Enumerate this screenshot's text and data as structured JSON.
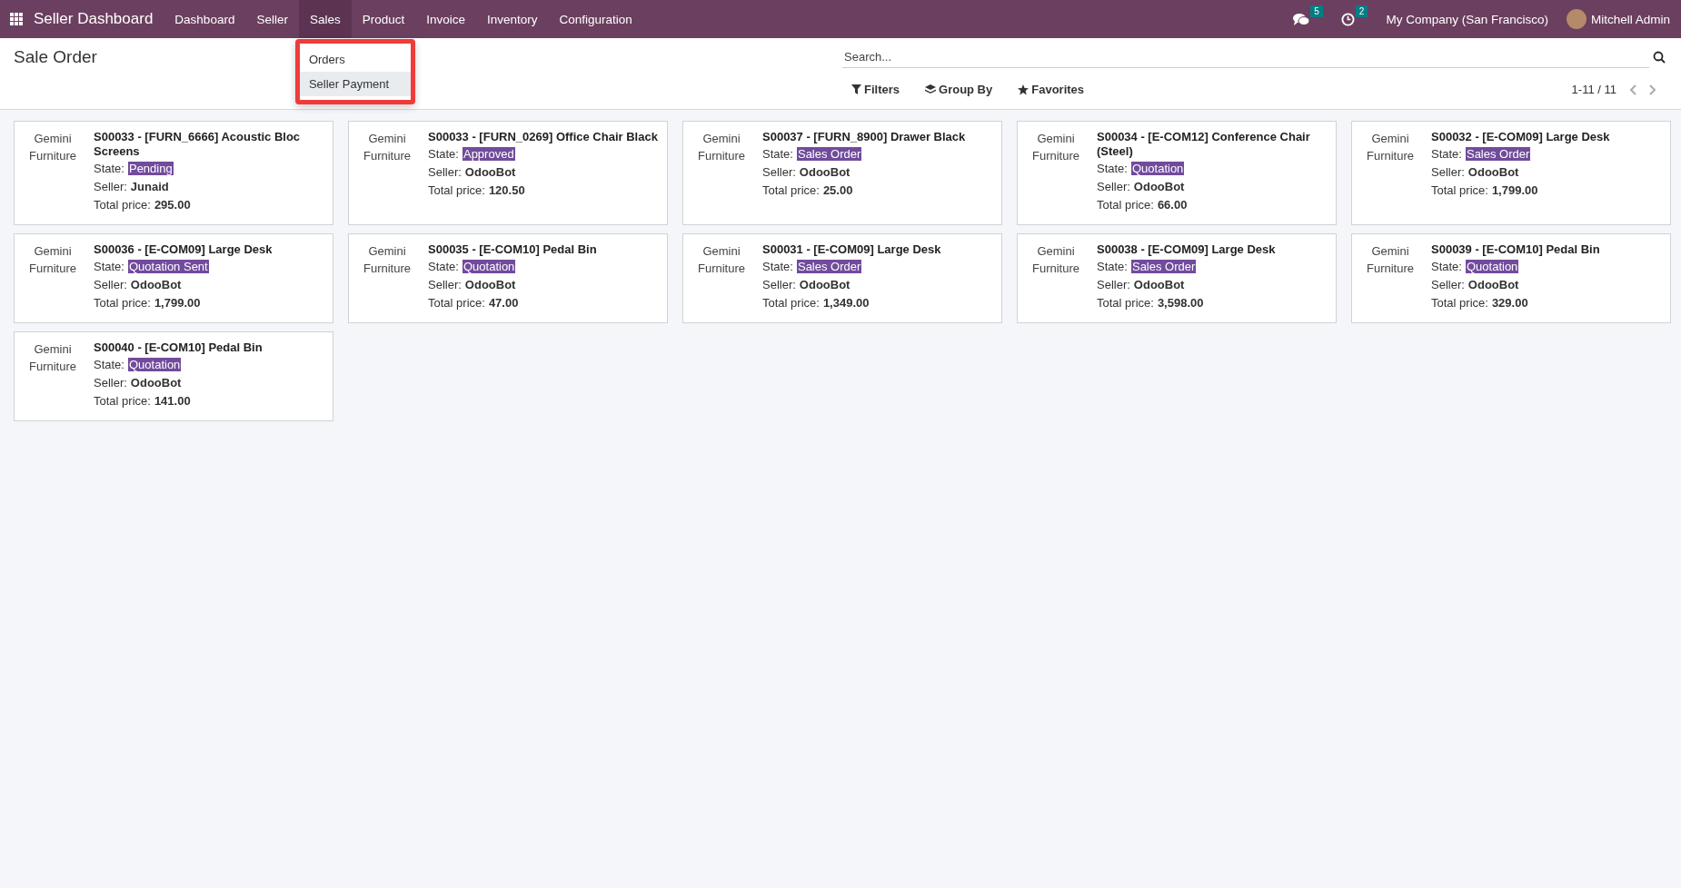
{
  "navbar": {
    "app_title": "Seller Dashboard",
    "menu": [
      {
        "label": "Dashboard",
        "selected": false
      },
      {
        "label": "Seller",
        "selected": false
      },
      {
        "label": "Sales",
        "selected": true
      },
      {
        "label": "Product",
        "selected": false
      },
      {
        "label": "Invoice",
        "selected": false
      },
      {
        "label": "Inventory",
        "selected": false
      },
      {
        "label": "Configuration",
        "selected": false
      }
    ],
    "messages_count": "5",
    "activities_count": "2",
    "company": "My Company (San Francisco)",
    "user": "Mitchell Admin"
  },
  "dropdown": {
    "items": [
      {
        "label": "Orders",
        "selected": false
      },
      {
        "label": "Seller Payment",
        "selected": true
      }
    ]
  },
  "control_panel": {
    "title": "Sale Order",
    "search": {
      "placeholder": "Search..."
    },
    "filters": "Filters",
    "group_by": "Group By",
    "favorites": "Favorites",
    "pager": "1-11 / 11"
  },
  "cards": [
    {
      "company": "Gemini Furniture",
      "title": "S00033 - [FURN_6666] Acoustic Bloc Screens",
      "state_label": "State:",
      "state": "Pending",
      "seller_label": "Seller:",
      "seller": "Junaid",
      "price_label": "Total price:",
      "price": "295.00"
    },
    {
      "company": "Gemini Furniture",
      "title": "S00033 - [FURN_0269] Office Chair Black",
      "state_label": "State:",
      "state": "Approved",
      "seller_label": "Seller:",
      "seller": "OdooBot",
      "price_label": "Total price:",
      "price": "120.50"
    },
    {
      "company": "Gemini Furniture",
      "title": "S00037 - [FURN_8900] Drawer Black",
      "state_label": "State:",
      "state": "Sales Order",
      "seller_label": "Seller:",
      "seller": "OdooBot",
      "price_label": "Total price:",
      "price": "25.00"
    },
    {
      "company": "Gemini Furniture",
      "title": "S00034 - [E-COM12] Conference Chair (Steel)",
      "state_label": "State:",
      "state": "Quotation",
      "seller_label": "Seller:",
      "seller": "OdooBot",
      "price_label": "Total price:",
      "price": "66.00"
    },
    {
      "company": "Gemini Furniture",
      "title": "S00032 - [E-COM09] Large Desk",
      "state_label": "State:",
      "state": "Sales Order",
      "seller_label": "Seller:",
      "seller": "OdooBot",
      "price_label": "Total price:",
      "price": "1,799.00"
    },
    {
      "company": "Gemini Furniture",
      "title": "S00036 - [E-COM09] Large Desk",
      "state_label": "State:",
      "state": "Quotation Sent",
      "seller_label": "Seller:",
      "seller": "OdooBot",
      "price_label": "Total price:",
      "price": "1,799.00"
    },
    {
      "company": "Gemini Furniture",
      "title": "S00035 - [E-COM10] Pedal Bin",
      "state_label": "State:",
      "state": "Quotation",
      "seller_label": "Seller:",
      "seller": "OdooBot",
      "price_label": "Total price:",
      "price": "47.00"
    },
    {
      "company": "Gemini Furniture",
      "title": "S00031 - [E-COM09] Large Desk",
      "state_label": "State:",
      "state": "Sales Order",
      "seller_label": "Seller:",
      "seller": "OdooBot",
      "price_label": "Total price:",
      "price": "1,349.00"
    },
    {
      "company": "Gemini Furniture",
      "title": "S00038 - [E-COM09] Large Desk",
      "state_label": "State:",
      "state": "Sales Order",
      "seller_label": "Seller:",
      "seller": "OdooBot",
      "price_label": "Total price:",
      "price": "3,598.00"
    },
    {
      "company": "Gemini Furniture",
      "title": "S00039 - [E-COM10] Pedal Bin",
      "state_label": "State:",
      "state": "Quotation",
      "seller_label": "Seller:",
      "seller": "OdooBot",
      "price_label": "Total price:",
      "price": "329.00"
    },
    {
      "company": "Gemini Furniture",
      "title": "S00040 - [E-COM10] Pedal Bin",
      "state_label": "State:",
      "state": "Quotation",
      "seller_label": "Seller:",
      "seller": "OdooBot",
      "price_label": "Total price:",
      "price": "141.00"
    }
  ]
}
